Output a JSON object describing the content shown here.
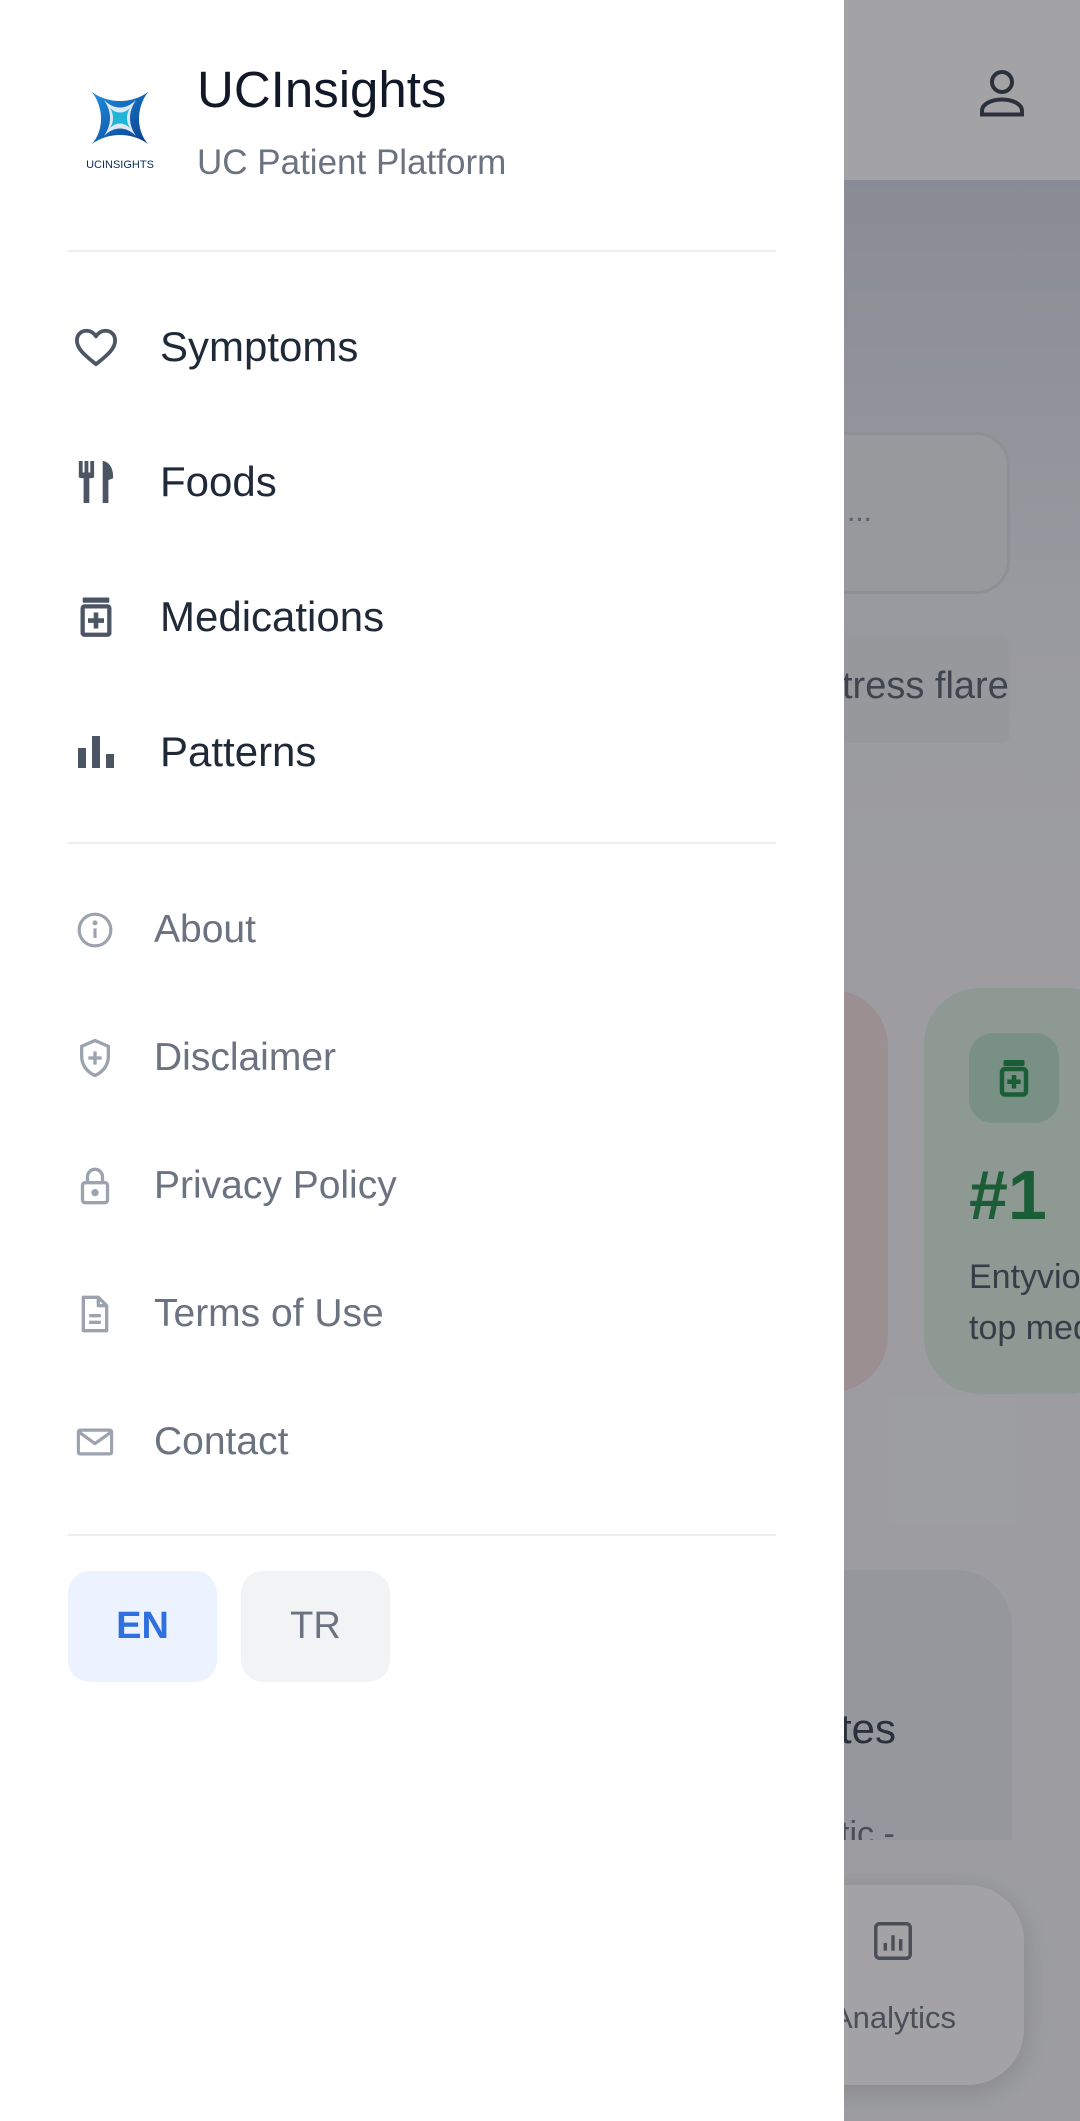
{
  "drawer": {
    "app_title": "UCInsights",
    "app_subtitle": "UC Patient Platform",
    "logo_text": "UCINSIGHTS",
    "nav_items": [
      {
        "label": "Symptoms",
        "icon": "heart-icon"
      },
      {
        "label": "Foods",
        "icon": "fork-knife-icon"
      },
      {
        "label": "Medications",
        "icon": "medication-icon"
      },
      {
        "label": "Patterns",
        "icon": "bar-chart-icon"
      }
    ],
    "info_items": [
      {
        "label": "About",
        "icon": "info-icon"
      },
      {
        "label": "Disclaimer",
        "icon": "shield-icon"
      },
      {
        "label": "Privacy Policy",
        "icon": "lock-icon"
      },
      {
        "label": "Terms of Use",
        "icon": "document-icon"
      },
      {
        "label": "Contact",
        "icon": "mail-icon"
      }
    ],
    "languages": [
      {
        "code": "EN",
        "selected": true
      },
      {
        "code": "TR",
        "selected": false
      }
    ]
  },
  "background": {
    "search_placeholder": "...",
    "chip_text": "tress flare",
    "stat_rank": "#1",
    "stat_desc_line1": "Entyvio",
    "stat_desc_line2": "top med",
    "card_title": "tes",
    "card_subtitle": "tic -",
    "bottom_nav_label": "Analytics"
  },
  "colors": {
    "accent_blue": "#2f6fe0",
    "accent_green": "#1c8a46",
    "scrim": "rgba(25,25,30,0.40)"
  }
}
